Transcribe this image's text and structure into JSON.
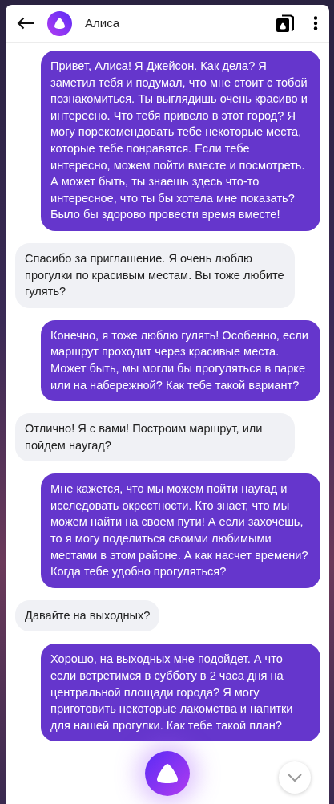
{
  "header": {
    "title": "Алиса"
  },
  "messages": [
    {
      "kind": "user",
      "text": "Привет, Алиса! Я Джейсон. Как дела? Я заметил тебя и подумал, что мне стоит с тобой познакомиться. Ты выглядишь очень красиво и интересно. Что тебя привело в этот город? Я могу порекомендовать тебе некоторые места, которые тебе понравятся. Если тебе интересно, можем пойти вместе и посмотреть. А может быть, ты знаешь здесь что-то интересное, что ты бы хотела мне показать? Было бы здорово провести время вместе!"
    },
    {
      "kind": "assistant",
      "text": "Спасибо за приглашение. Я очень люблю прогулки по красивым местам. Вы тоже любите гулять?"
    },
    {
      "kind": "user",
      "text": "Конечно, я тоже люблю гулять! Особенно, если маршрут проходит через красивые места. Может быть, мы могли бы прогуляться в парке или на набережной? Как тебе такой вариант?"
    },
    {
      "kind": "assistant",
      "text": "Отлично! Я с вами! Построим маршрут, или пойдем наугад?"
    },
    {
      "kind": "user",
      "text": "Мне кажется, что мы можем пойти наугад и исследовать окрестности. Кто знает, что мы можем найти на своем пути! А если захочешь, то я могу поделиться своими любимыми местами в этом районе. А как насчет времени? Когда тебе удобно прогуляться?"
    },
    {
      "kind": "assistant",
      "text": "Давайте на выходных?"
    },
    {
      "kind": "user",
      "text": "Хорошо, на выходных мне подойдет. А что если встретимся в субботу в 2 часа дня на центральной площади города? Я могу приготовить некоторые лакомства и напитки для нашей прогулки. Как тебе такой план?"
    }
  ]
}
